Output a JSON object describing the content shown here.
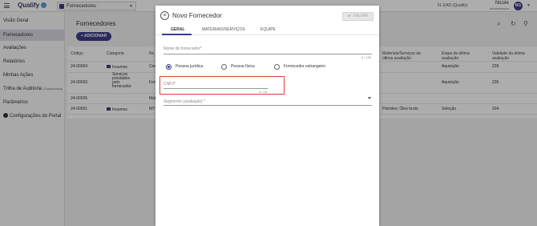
{
  "topbar": {
    "brand": "Qualify",
    "module": "Fornecedores",
    "company": "FL EAD (Qualify)",
    "user_name": "Nicole",
    "user_role": "administrador",
    "avatar_initials": "NG"
  },
  "sidebar": {
    "items": [
      {
        "label": "Visão Geral"
      },
      {
        "label": "Fornecedores"
      },
      {
        "label": "Avaliações"
      },
      {
        "label": "Relatórios"
      },
      {
        "label": "Minhas Ações"
      },
      {
        "label": "Trilha de Auditoria",
        "note": "(Simplificada)"
      },
      {
        "label": "Parâmetros"
      },
      {
        "label": "Configurações do Portal"
      }
    ]
  },
  "main": {
    "title": "Fornecedores",
    "add_label": "+ ADICIONAR",
    "table": {
      "headers": [
        "Código",
        "Categoria",
        "No",
        "Materiais/Serviços da última avaliação",
        "Etapa da última avaliação",
        "Validade da última avaliação"
      ],
      "rows": [
        {
          "code": "24-00004",
          "category": "Insumos",
          "name": "Cre",
          "materials": "",
          "stage": "Aquisição",
          "validity": "239"
        },
        {
          "code": "24-00003",
          "category": "Serviços prestados pelo fornecedor",
          "name": "Fort",
          "materials": "",
          "stage": "Aquisição",
          "validity": "235"
        },
        {
          "code": "24-00005",
          "category": "",
          "name": "Mat",
          "materials": "",
          "stage": "",
          "validity": ""
        },
        {
          "code": "24-00001",
          "category": "Insumos",
          "name": "MYT",
          "materials": "Petróleo, Óleo bruto",
          "stage": "Seleção",
          "validity": "204"
        }
      ]
    }
  },
  "modal": {
    "title": "Novo Fornecedor",
    "save_label": "SALVAR",
    "tabs": [
      "GERAL",
      "MATERIAIS/SERVIÇOS",
      "EQUIPE"
    ],
    "name_placeholder": "Nome do fornecedor*",
    "name_counter": "0 / 100",
    "radios": [
      "Pessoa jurídica",
      "Pessoa física",
      "Fornecedor estrangeiro"
    ],
    "cnpj_label": "CNPJ*",
    "cnpj_counter": "0 / 18",
    "segment_placeholder": "Segmento (avaliação) *"
  }
}
